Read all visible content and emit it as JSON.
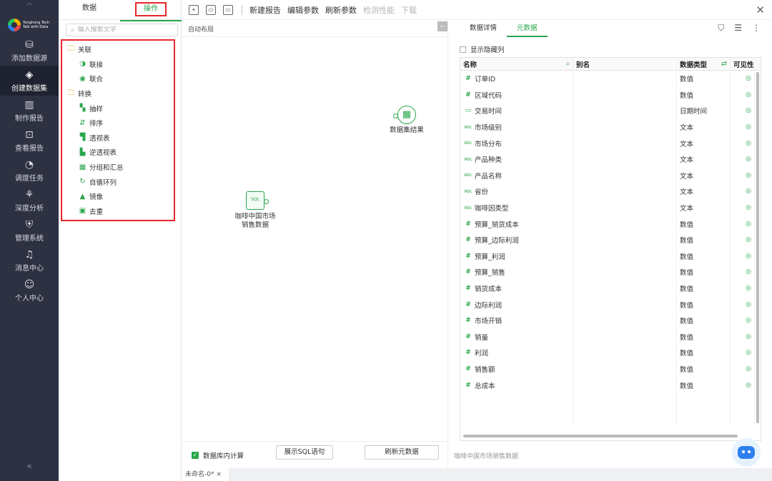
{
  "app": {
    "logo_text": "Yonghong Tech",
    "logo_sub": "Talk with Data"
  },
  "nav": {
    "items": [
      {
        "label": "添加数据源",
        "icon": "database-icon"
      },
      {
        "label": "创建数据集",
        "icon": "layers-icon",
        "active": true
      },
      {
        "label": "制作报告",
        "icon": "bar-chart-icon"
      },
      {
        "label": "查看报告",
        "icon": "monitor-chart-icon"
      },
      {
        "label": "调度任务",
        "icon": "clock-icon"
      },
      {
        "label": "深度分析",
        "icon": "network-icon"
      },
      {
        "label": "管理系统",
        "icon": "shield-icon"
      },
      {
        "label": "消息中心",
        "icon": "bell-icon"
      },
      {
        "label": "个人中心",
        "icon": "user-icon"
      }
    ]
  },
  "ops": {
    "tabs": [
      {
        "label": "数据"
      },
      {
        "label": "操作",
        "active": true
      }
    ],
    "search_placeholder": "输入搜索文字",
    "tree": [
      {
        "label": "关联",
        "type": "group",
        "icon": "folder-icon"
      },
      {
        "label": "联接",
        "type": "leaf",
        "icon": "join-icon"
      },
      {
        "label": "联合",
        "type": "leaf",
        "icon": "union-icon"
      },
      {
        "label": "转换",
        "type": "group",
        "icon": "folder-icon"
      },
      {
        "label": "抽样",
        "type": "leaf",
        "icon": "sample-icon"
      },
      {
        "label": "排序",
        "type": "leaf",
        "icon": "sort-icon"
      },
      {
        "label": "透视表",
        "type": "leaf",
        "icon": "pivot-icon"
      },
      {
        "label": "逆透视表",
        "type": "leaf",
        "icon": "unpivot-icon"
      },
      {
        "label": "分组和汇总",
        "type": "leaf",
        "icon": "group-icon"
      },
      {
        "label": "自循环列",
        "type": "leaf",
        "icon": "loop-icon"
      },
      {
        "label": "镜像",
        "type": "leaf",
        "icon": "mirror-icon"
      },
      {
        "label": "去重",
        "type": "leaf",
        "icon": "dedupe-icon"
      }
    ]
  },
  "toolbar": {
    "buttons": [
      {
        "label": "新建报告",
        "disabled": false
      },
      {
        "label": "编辑参数",
        "disabled": false
      },
      {
        "label": "刷新参数",
        "disabled": false
      },
      {
        "label": "检测性能",
        "disabled": true
      },
      {
        "label": "下载",
        "disabled": true
      }
    ]
  },
  "canvas": {
    "layout_label": "自动布局",
    "sql_node": {
      "label_line1": "咖啡中国市场",
      "label_line2": "销售数据",
      "badge": "SQL"
    },
    "result_node": {
      "label": "数据集结果"
    },
    "db_calc_label": "数据库内计算",
    "show_sql_label": "展示SQL语句",
    "refresh_meta_label": "刷新元数据"
  },
  "doc_tab": {
    "label": "未命名-0*"
  },
  "panel": {
    "tabs": [
      {
        "label": "数据详情"
      },
      {
        "label": "元数据",
        "active": true
      }
    ],
    "show_hidden_label": "显示隐藏列",
    "columns": {
      "name": "名称",
      "alias": "别名",
      "type": "数据类型",
      "visible": "可见性"
    },
    "rows": [
      {
        "name": "订单ID",
        "type": "数值",
        "icon": "#"
      },
      {
        "name": "区域代码",
        "type": "数值",
        "icon": "#"
      },
      {
        "name": "交易时间",
        "type": "日期时间",
        "icon": "cal"
      },
      {
        "name": "市场级别",
        "type": "文本",
        "icon": "Abc"
      },
      {
        "name": "市场分布",
        "type": "文本",
        "icon": "Abc"
      },
      {
        "name": "产品种类",
        "type": "文本",
        "icon": "Abc"
      },
      {
        "name": "产品名称",
        "type": "文本",
        "icon": "Abc"
      },
      {
        "name": "省份",
        "type": "文本",
        "icon": "Abc"
      },
      {
        "name": "咖啡因类型",
        "type": "文本",
        "icon": "Abc"
      },
      {
        "name": "预算_销货成本",
        "type": "数值",
        "icon": "#"
      },
      {
        "name": "预算_边际利润",
        "type": "数值",
        "icon": "#"
      },
      {
        "name": "预算_利润",
        "type": "数值",
        "icon": "#"
      },
      {
        "name": "预算_销售",
        "type": "数值",
        "icon": "#"
      },
      {
        "name": "销货成本",
        "type": "数值",
        "icon": "#"
      },
      {
        "name": "边际利润",
        "type": "数值",
        "icon": "#"
      },
      {
        "name": "市场开销",
        "type": "数值",
        "icon": "#"
      },
      {
        "name": "销量",
        "type": "数值",
        "icon": "#"
      },
      {
        "name": "利润",
        "type": "数值",
        "icon": "#"
      },
      {
        "name": "销售额",
        "type": "数值",
        "icon": "#"
      },
      {
        "name": "总成本",
        "type": "数值",
        "icon": "#"
      }
    ],
    "footer_label": "咖啡中国市场销售数据"
  }
}
